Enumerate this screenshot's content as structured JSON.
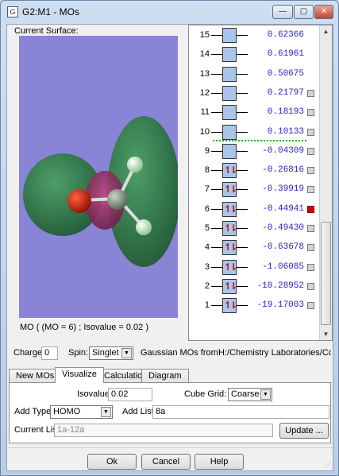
{
  "window": {
    "title": "G2:M1 - MOs"
  },
  "titlebar_buttons": {
    "minimize": "—",
    "maximize": "▢",
    "close": "✕"
  },
  "viewer": {
    "current_surface_label": "Current Surface:",
    "caption": "MO ( (MO = 6) ; Isovalue = 0.02 )"
  },
  "mo_list": [
    {
      "index": "15",
      "energy": "0.62366",
      "occupied": false,
      "has_check": false,
      "checked": false
    },
    {
      "index": "14",
      "energy": "0.61961",
      "occupied": false,
      "has_check": false,
      "checked": false
    },
    {
      "index": "13",
      "energy": "0.50675",
      "occupied": false,
      "has_check": false,
      "checked": false
    },
    {
      "index": "12",
      "energy": "0.21797",
      "occupied": false,
      "has_check": true,
      "checked": false
    },
    {
      "index": "11",
      "energy": "0.18193",
      "occupied": false,
      "has_check": true,
      "checked": false
    },
    {
      "index": "10",
      "energy": "0.10133",
      "occupied": false,
      "has_check": true,
      "checked": false
    },
    {
      "index": "9",
      "energy": "-0.04309",
      "occupied": false,
      "has_check": true,
      "checked": false
    },
    {
      "index": "8",
      "energy": "-0.26816",
      "occupied": true,
      "has_check": true,
      "checked": false
    },
    {
      "index": "7",
      "energy": "-0.39919",
      "occupied": true,
      "has_check": true,
      "checked": false
    },
    {
      "index": "6",
      "energy": "-0.44941",
      "occupied": true,
      "has_check": true,
      "checked": true
    },
    {
      "index": "5",
      "energy": "-0.49430",
      "occupied": true,
      "has_check": true,
      "checked": false
    },
    {
      "index": "4",
      "energy": "-0.63678",
      "occupied": true,
      "has_check": true,
      "checked": false
    },
    {
      "index": "3",
      "energy": "-1.06085",
      "occupied": true,
      "has_check": true,
      "checked": false
    },
    {
      "index": "2",
      "energy": "-10.28952",
      "occupied": true,
      "has_check": true,
      "checked": false
    },
    {
      "index": "1",
      "energy": "-19.17003",
      "occupied": true,
      "has_check": true,
      "checked": false
    }
  ],
  "electron_glyph": "↿⇂",
  "charge": {
    "label": "Charge:",
    "value": "0"
  },
  "spin": {
    "label": "Spin:",
    "value": "Singlet"
  },
  "source": {
    "label": "Gaussian MOs from:",
    "path": "H:/Chemistry Laboratories/Compu"
  },
  "tabs": [
    {
      "label": "New MOs",
      "active": false
    },
    {
      "label": "Visualize",
      "active": true
    },
    {
      "label": "Calculation",
      "active": false
    },
    {
      "label": "Diagram",
      "active": false
    }
  ],
  "visualize": {
    "isovalue_label": "Isovalue:",
    "isovalue": "0.02",
    "cube_grid_label": "Cube Grid:",
    "cube_grid": "Coarse",
    "add_type_label": "Add Type:",
    "add_type": "HOMO",
    "add_list_label": "Add List:",
    "add_list": "8a",
    "current_list_label": "Current List:",
    "current_list": "1a-12a",
    "update_button": "Update ..."
  },
  "footer": {
    "ok": "Ok",
    "cancel": "Cancel",
    "help": "Help"
  },
  "colors": {
    "viewer_bg": "#8a84d6",
    "lobe_green": "#2f7a45",
    "lobe_magenta": "#a0306a",
    "oxygen": "#c81e0a",
    "carbon": "#7c8c7e",
    "hydrogen": "#c8f0c0",
    "energy_text": "#2424c8",
    "homo_separator": "#20b020",
    "selected_check": "#d80000"
  }
}
